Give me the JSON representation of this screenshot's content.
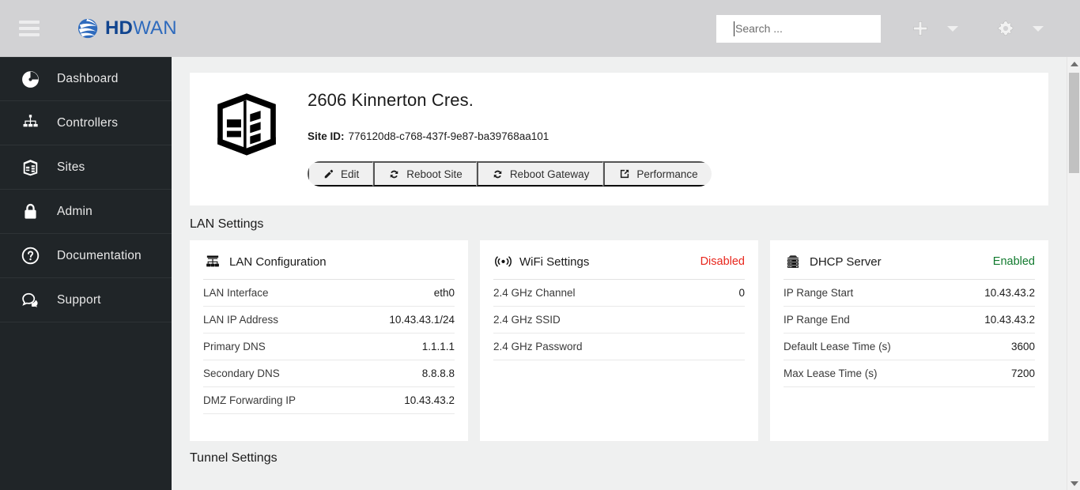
{
  "header": {
    "menu_icon": "hamburger-icon",
    "logo": {
      "mark": "swoosh-globe-icon",
      "primary": "HD",
      "secondary": "WAN"
    },
    "search": {
      "placeholder": "Search ...",
      "value": ""
    },
    "add_icon": "plus-icon",
    "add_caret": "chevron-down-icon",
    "settings_icon": "gear-icon",
    "settings_caret": "chevron-down-icon"
  },
  "sidebar": {
    "items": [
      {
        "label": "Dashboard",
        "icon": "gauge-icon"
      },
      {
        "label": "Controllers",
        "icon": "hierarchy-icon"
      },
      {
        "label": "Sites",
        "icon": "building-icon"
      },
      {
        "label": "Admin",
        "icon": "lock-icon"
      },
      {
        "label": "Documentation",
        "icon": "question-circle-icon"
      },
      {
        "label": "Support",
        "icon": "chat-bubbles-icon"
      }
    ]
  },
  "site": {
    "icon": "building-3d-icon",
    "title": "2606 Kinnerton Cres.",
    "site_id_label": "Site ID:",
    "site_id_value": "776120d8-c768-437f-9e87-ba39768aa101",
    "actions": [
      {
        "label": "Edit",
        "icon": "pencil-icon"
      },
      {
        "label": "Reboot Site",
        "icon": "refresh-icon"
      },
      {
        "label": "Reboot Gateway",
        "icon": "refresh-icon"
      },
      {
        "label": "Performance",
        "icon": "external-link-icon"
      }
    ]
  },
  "sections": {
    "lan_settings_title": "LAN Settings",
    "tunnel_settings_title": "Tunnel Settings"
  },
  "cards": {
    "lan": {
      "icon": "sitemap-icon",
      "title": "LAN Configuration",
      "status": "",
      "rows": [
        {
          "key": "LAN Interface",
          "value": "eth0"
        },
        {
          "key": "LAN IP Address",
          "value": "10.43.43.1/24"
        },
        {
          "key": "Primary DNS",
          "value": "1.1.1.1"
        },
        {
          "key": "Secondary DNS",
          "value": "8.8.8.8"
        },
        {
          "key": "DMZ Forwarding IP",
          "value": "10.43.43.2"
        }
      ]
    },
    "wifi": {
      "icon": "wifi-broadcast-icon",
      "title": "WiFi Settings",
      "status": "Disabled",
      "status_color": "#e8261c",
      "rows": [
        {
          "key": "2.4 GHz Channel",
          "value": "0"
        },
        {
          "key": "2.4 GHz SSID",
          "value": ""
        },
        {
          "key": "2.4 GHz Password",
          "value": ""
        }
      ]
    },
    "dhcp": {
      "icon": "server-rack-icon",
      "title": "DHCP Server",
      "status": "Enabled",
      "status_color": "#117a2e",
      "rows": [
        {
          "key": "IP Range Start",
          "value": "10.43.43.2"
        },
        {
          "key": "IP Range End",
          "value": "10.43.43.2"
        },
        {
          "key": "Default Lease Time (s)",
          "value": "3600"
        },
        {
          "key": "Max Lease Time (s)",
          "value": "7200"
        }
      ]
    }
  },
  "scrollbar": {
    "up_icon": "triangle-up-icon",
    "down_icon": "triangle-down-icon"
  },
  "colors": {
    "header_bg": "#d2d2d4",
    "sidebar_bg": "#202528",
    "content_bg": "#eff0f0",
    "brand_blue": "#10448f",
    "brand_blue_light": "#2f6bbd"
  }
}
